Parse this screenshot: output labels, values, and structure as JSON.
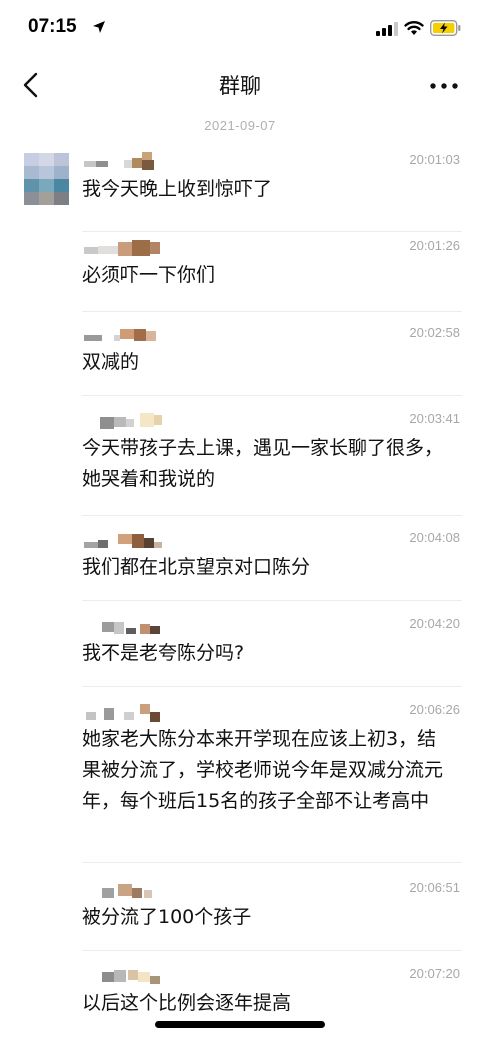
{
  "status": {
    "time": "07:15"
  },
  "nav": {
    "title": "群聊"
  },
  "date_separator": "2021-09-07",
  "messages": [
    {
      "time": "20:01:03",
      "text": "我今天晚上收到惊吓了"
    },
    {
      "time": "20:01:26",
      "text": "必须吓一下你们"
    },
    {
      "time": "20:02:58",
      "text": "双减的"
    },
    {
      "time": "20:03:41",
      "text": "今天带孩子去上课，遇见一家长聊了很多，她哭着和我说的"
    },
    {
      "time": "20:04:08",
      "text": "我们都在北京望京对口陈分"
    },
    {
      "time": "20:04:20",
      "text": "我不是老夸陈分吗?"
    },
    {
      "time": "20:06:26",
      "text": "她家老大陈分本来开学现在应该上初3，结果被分流了，学校老师说今年是双减分流元年，每个班后15名的孩子全部不让考高中"
    },
    {
      "time": "20:06:51",
      "text": "被分流了100个孩子"
    },
    {
      "time": "20:07:20",
      "text": "以后这个比例会逐年提高"
    }
  ],
  "icons": {
    "back": "chevron-left-icon",
    "more": "more-dots-icon",
    "location": "location-arrow-icon",
    "signal": "cellular-signal-icon",
    "wifi": "wifi-icon",
    "battery": "battery-charging-icon"
  },
  "colors": {
    "timestamp": "#a8a8a8",
    "battery": "#f5d000"
  }
}
